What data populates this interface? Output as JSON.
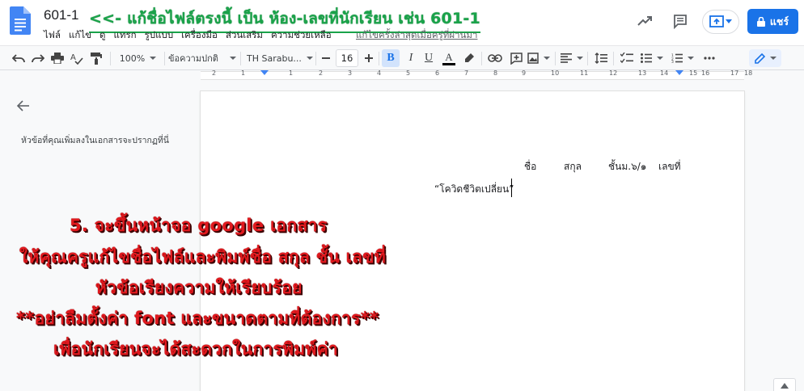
{
  "header": {
    "doc_title": "601-1",
    "overlay_title": "<<- แก้ชื่อไฟล์ตรงนี้ เป็น ห้อง-เลขที่นักเรียน เช่น 601-1",
    "menu": [
      "ไฟล์",
      "แก้ไข",
      "ดู",
      "แทรก",
      "รูปแบบ",
      "เครื่องมือ",
      "ส่วนเสริม",
      "ความช่วยเหลือ"
    ],
    "last_edit": "แก้ไขครั้งล่าสุดเมื่อครู่ที่ผ่านมา",
    "share_label": "แชร์"
  },
  "toolbar": {
    "zoom": "100%",
    "style": "ข้อความปกติ",
    "font": "TH Sarabu...",
    "size": "16",
    "bold": "B",
    "italic": "I",
    "underline": "U",
    "text_color": "A"
  },
  "ruler": {
    "numbers": [
      "2",
      "1",
      "1",
      "2",
      "3",
      "4",
      "5",
      "6",
      "7",
      "8",
      "9",
      "10",
      "11",
      "12",
      "13",
      "14",
      "15",
      "16",
      "17",
      "18"
    ]
  },
  "sidebar": {
    "hint": "หัวข้อที่คุณเพิ่มลงในเอกสารจะปรากฏที่นี่"
  },
  "document": {
    "name_label": "ชื่อ",
    "surname_label": "สกุล",
    "class_label": "ชั้นม.๖/๑",
    "number_label": "เลขที่",
    "essay_title": "“โควิดชีวิตเปลี่ยน”"
  },
  "instructions": [
    "5. จะขึ้นหน้าจอ google เอกสาร",
    "ให้คุณครูแก้ไขชื่อไฟล์และพิมพ์ชื่อ สกุล ชั้น เลขที่",
    "หัวข้อเรียงความให้เรียบร้อย",
    "**อย่าลืมตั้งค่า font และขนาดตามที่ต้องการ**",
    "เพื่อนักเรียนจะได้สะดวกในการพิมพ์ค่า"
  ],
  "colors": {
    "accent_blue": "#1a73e8",
    "instruction_red": "#e0191e",
    "overlay_green": "#1aa34a"
  }
}
